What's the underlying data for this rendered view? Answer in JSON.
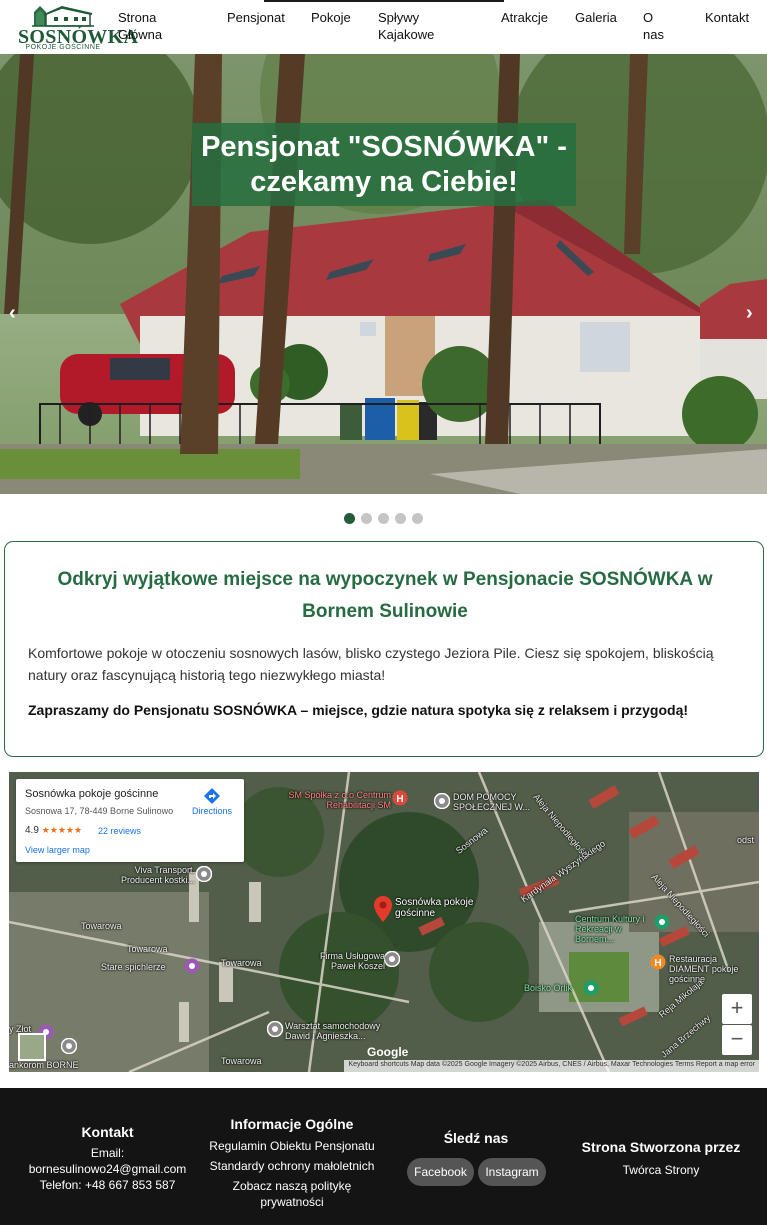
{
  "brand": {
    "name": "SOSNÓWKA",
    "tagline": "POKOJE GOŚCINNE"
  },
  "nav": {
    "items": [
      {
        "label": "Strona Główna"
      },
      {
        "label": "Pensjonat"
      },
      {
        "label": "Pokoje"
      },
      {
        "label": "Spływy Kajakowe"
      },
      {
        "label": "Atrakcje"
      },
      {
        "label": "Galeria"
      },
      {
        "label": "O nas"
      },
      {
        "label": "Kontakt"
      }
    ]
  },
  "hero": {
    "title": "Pensjonat \"SOSNÓWKA\" - czekamy na Ciebie!",
    "prev_glyph": "‹",
    "next_glyph": "›",
    "slides_count": 5,
    "active_slide": 1
  },
  "intro": {
    "title": "Odkryj wyjątkowe miejsce na wypoczynek w Pensjonacie SOSNÓWKA w Bornem Sulinowie",
    "text": "Komfortowe pokoje w otoczeniu sosnowych lasów, blisko czystego Jeziora Pile. Ciesz się spokojem, bliskością natury oraz fascynującą historią tego niezwykłego miasta!",
    "strong": "Zapraszamy do Pensjonatu SOSNÓWKA – miejsce, gdzie natura spotyka się z relaksem i przygodą!"
  },
  "map": {
    "place_name": "Sosnówka pokoje gościnne",
    "address": "Sosnowa 17, 78-449 Borne Sulinowo",
    "rating": "4.9",
    "stars": "★★★★★",
    "reviews": "22 reviews",
    "larger_map": "View larger map",
    "directions": "Directions",
    "zoom_in": "+",
    "zoom_out": "−",
    "google": "Google",
    "attribution": "Keyboard shortcuts   Map data ©2025 Google Imagery ©2025 Airbus, CNES / Airbus, Maxar Technologies   Terms   Report a map error",
    "labels": {
      "sm": "SM Spółka z o.o Centrum Rehabilitacji SM",
      "dom": "DOM POMOCY SPOŁECZNEJ W...",
      "viva": "Viva Transport. Producent kostki...",
      "sosnowka": "Sosnówka pokoje gościnne",
      "firma": "Firma Usługowa Paweł Koszel",
      "stare": "Stare spichlerze",
      "warsztat": "Warsztat samochodowy Dawid i Agnieszka...",
      "centrum": "Centrum Kultury i Rekreacji w Bornem...",
      "restauracja": "Restauracja DIAMENT pokoje gościnne",
      "boisko": "Boisko Orlik",
      "towarowa": "Towarowa",
      "kardynala": "Kardynała Wyszyńskiego",
      "aleja": "Aleja Niepodległości",
      "mikolaja": "Reja Mikołaja",
      "jana": "Jana Brzechwy",
      "sosnowa": "Sosnowa",
      "borne": "ankorom BORNE",
      "zlot": "y Złot",
      "odst": "odst"
    }
  },
  "footer": {
    "contact": {
      "heading": "Kontakt",
      "email_label": "Email:",
      "email": "bornesulinowo24@gmail.com",
      "phone": "Telefon: +48 667 853 587"
    },
    "info": {
      "heading": "Informacje Ogólne",
      "links": [
        "Regulamin Obiektu Pensjonatu",
        "Standardy ochrony małoletnich",
        "Zobacz naszą politykę prywatności"
      ]
    },
    "social": {
      "heading": "Śledź nas",
      "facebook": "Facebook",
      "instagram": "Instagram"
    },
    "credits": {
      "heading": "Strona Stworzona przez",
      "author": "Twórca Strony"
    }
  },
  "colors": {
    "brand_green": "#276b42",
    "dot_active": "#245c3a",
    "footer_bg": "#141414"
  }
}
